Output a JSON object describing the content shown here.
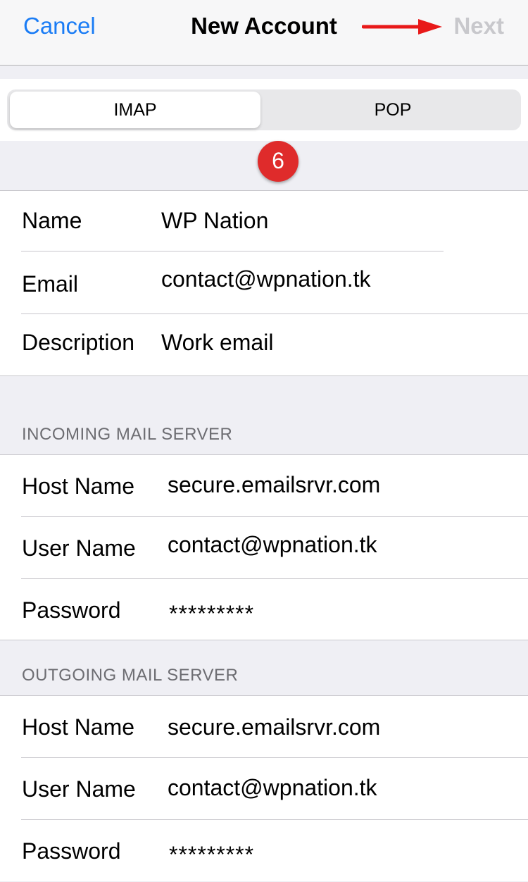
{
  "navbar": {
    "cancel_label": "Cancel",
    "title": "New Account",
    "next_label": "Next"
  },
  "segmented": {
    "options": [
      "IMAP",
      "POP"
    ],
    "selected": "IMAP"
  },
  "step_badge": "6",
  "account": {
    "rows": [
      {
        "label": "Name",
        "value": "WP Nation"
      },
      {
        "label": "Email",
        "value": "contact@wpnation.tk"
      },
      {
        "label": "Description",
        "value": "Work email"
      }
    ]
  },
  "incoming": {
    "header": "INCOMING MAIL SERVER",
    "rows": [
      {
        "label": "Host Name",
        "value": "secure.emailsrvr.com"
      },
      {
        "label": "User Name",
        "value": "contact@wpnation.tk"
      },
      {
        "label": "Password",
        "value": "*********"
      }
    ]
  },
  "outgoing": {
    "header": "OUTGOING MAIL SERVER",
    "rows": [
      {
        "label": "Host Name",
        "value": "secure.emailsrvr.com"
      },
      {
        "label": "User Name",
        "value": "contact@wpnation.tk"
      },
      {
        "label": "Password",
        "value": "*********"
      }
    ]
  },
  "colors": {
    "accent": "#1a7cf5",
    "disabled": "#c8c8cc",
    "annotation": "#df2b2b",
    "background": "#efeff4"
  }
}
